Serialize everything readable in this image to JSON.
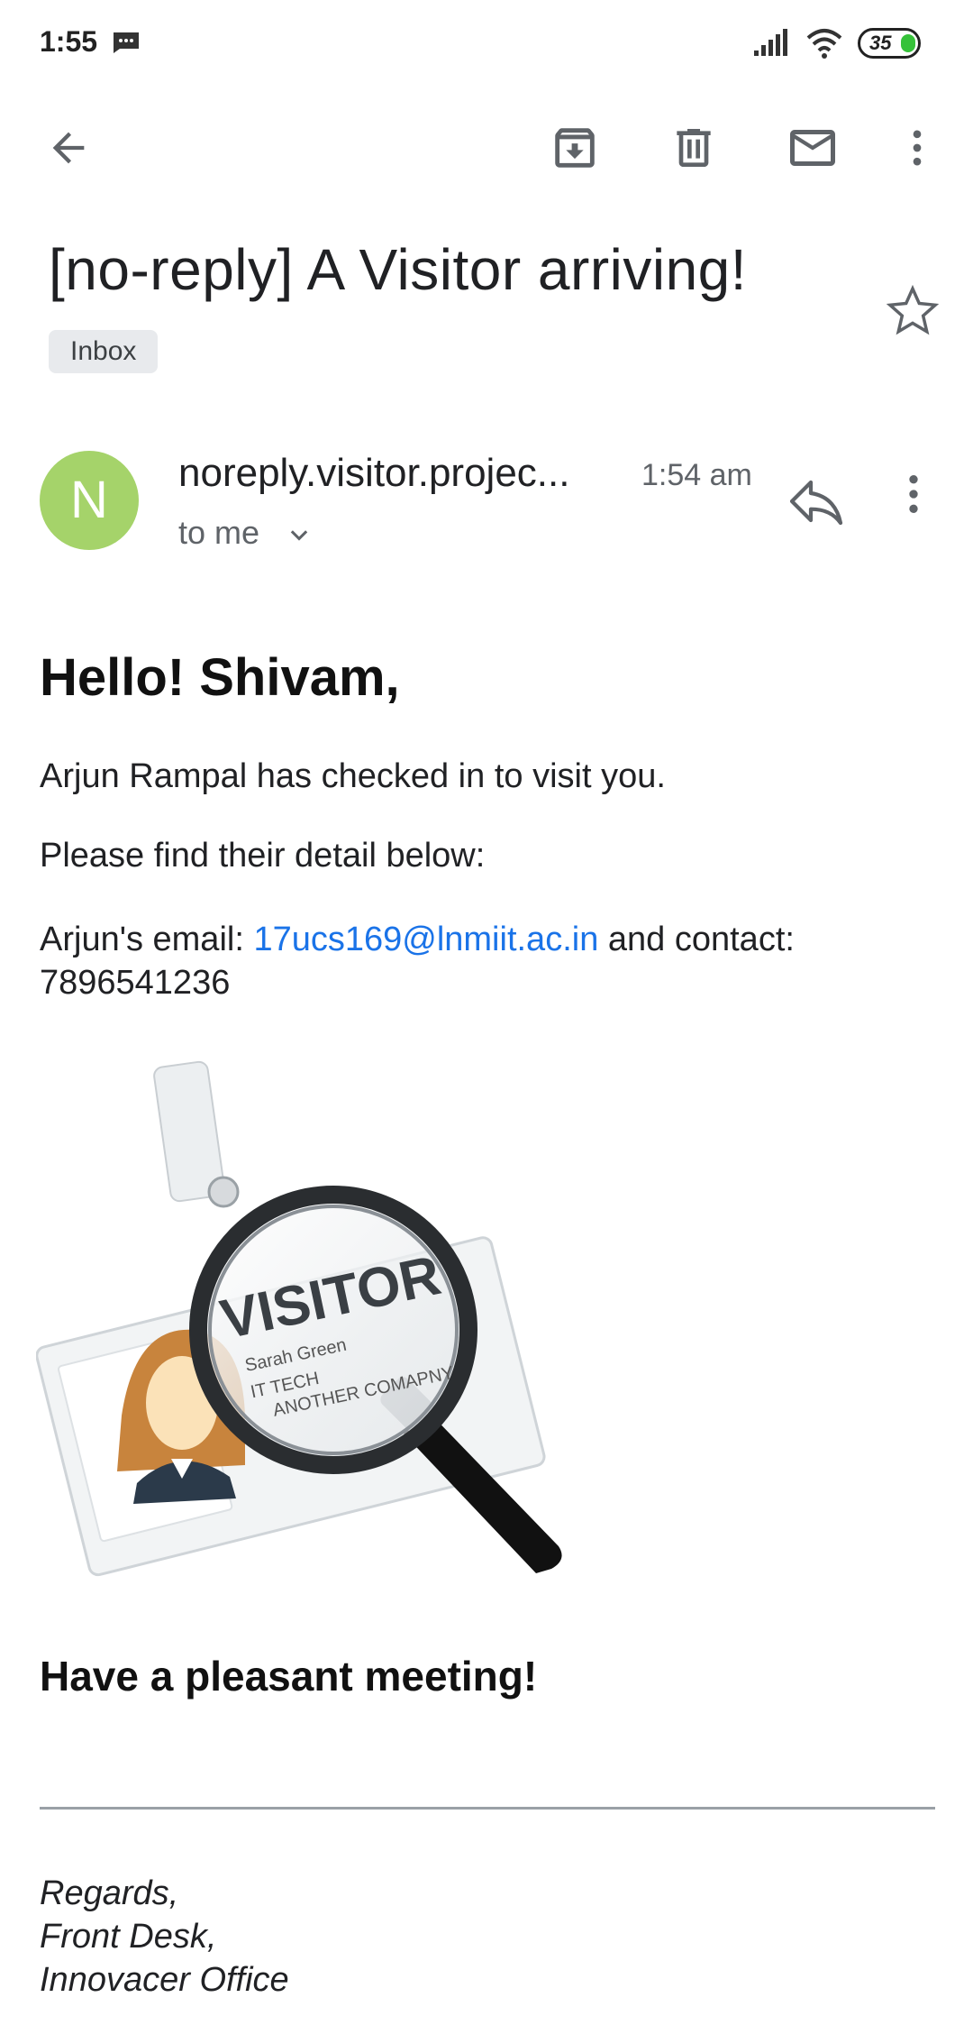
{
  "status_bar": {
    "time": "1:55",
    "battery": "35"
  },
  "email": {
    "subject": "[no-reply] A Visitor arriving!",
    "label": "Inbox",
    "sender_initial": "N",
    "sender": "noreply.visitor.projec...",
    "time": "1:54 am",
    "to": "to me",
    "greeting": "Hello! Shivam,",
    "line1": "Arjun Rampal has checked in to visit you.",
    "line2": "Please find their detail below:",
    "email_prefix": "Arjun's email: ",
    "email_address": "17ucs169@lnmiit.ac.in",
    "contact_text": " and contact: 7896541236",
    "closing": "Have a pleasant meeting!",
    "signature": [
      "Regards,",
      "Front Desk,",
      "Innovacer Office"
    ],
    "badge_text": {
      "title": "VISITOR",
      "line1": "Sarah Green",
      "line2": "IT TECH",
      "line3": "ANOTHER COMAPNY"
    }
  },
  "colors": {
    "accent": "#1a73e8",
    "avatar": "#a5d36a",
    "battery": "#36c23a"
  },
  "icons": [
    "back-arrow-icon",
    "archive-icon",
    "delete-icon",
    "mail-icon",
    "more-vert-icon",
    "star-icon",
    "reply-icon",
    "chevron-down-icon",
    "message-icon",
    "signal-icon",
    "wifi-icon",
    "battery-icon"
  ]
}
